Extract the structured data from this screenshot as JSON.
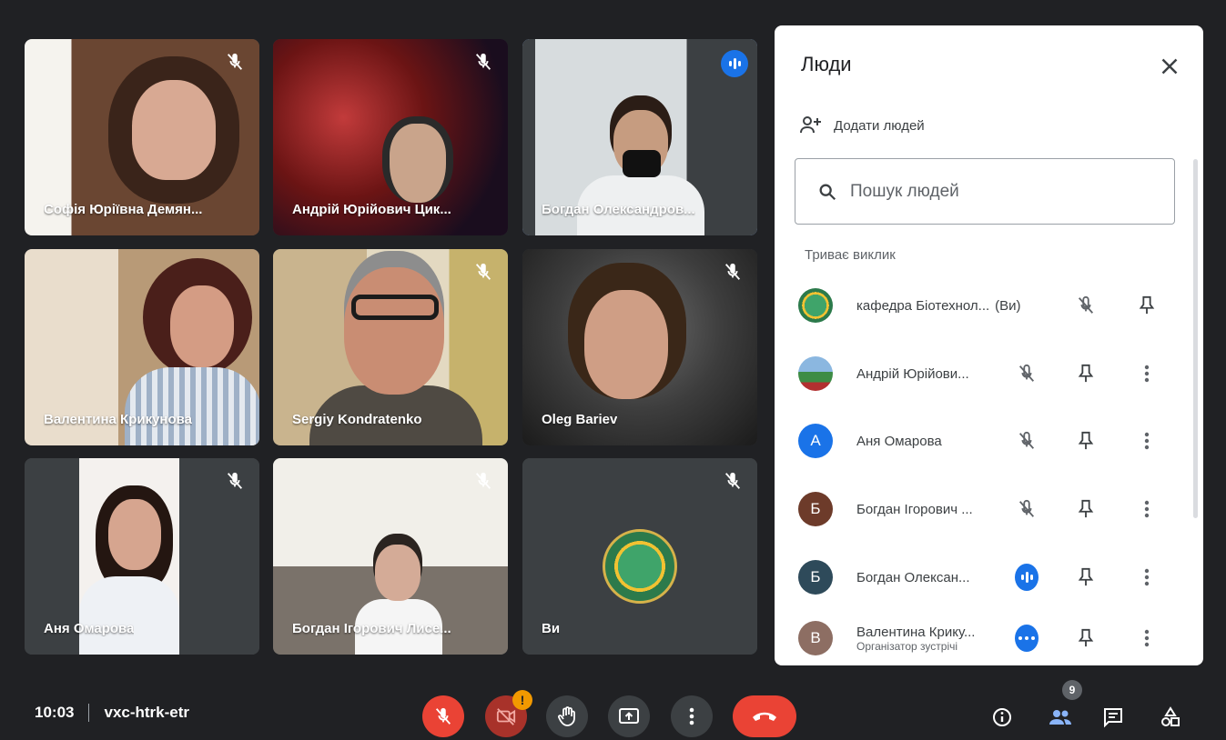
{
  "tiles": [
    {
      "name": "Софія Юріївна Демян...",
      "muted": true
    },
    {
      "name": "Андрій Юрійович Цик...",
      "muted": true
    },
    {
      "name": "Богдан Олександров...",
      "speaking": true
    },
    {
      "name": "Валентина Крикунова"
    },
    {
      "name": "Sergiy Kondratenko",
      "muted": true
    },
    {
      "name": "Oleg Bariev",
      "muted": true
    },
    {
      "name": "Аня Омарова",
      "muted": true
    },
    {
      "name": "Богдан Ігорович Лисе...",
      "muted": true
    },
    {
      "name": "Ви",
      "muted": true
    }
  ],
  "panel": {
    "title": "Люди",
    "add_people": "Додати людей",
    "search_placeholder": "Пошук людей",
    "section": "Триває виклик",
    "people": [
      {
        "name": "кафедра Біотехнол...",
        "you": "(Ви)",
        "status": "muted"
      },
      {
        "name": "Андрій Юрійови...",
        "status": "muted"
      },
      {
        "name": "Аня Омарова",
        "initial": "А",
        "color": "#1a73e8",
        "status": "muted"
      },
      {
        "name": "Богдан Ігорович ...",
        "initial": "Б",
        "color": "#6d3b2a",
        "status": "muted"
      },
      {
        "name": "Богдан Олексан...",
        "initial": "Б",
        "color": "#2e4a5a",
        "status": "speaking"
      },
      {
        "name": "Валентина Крику...",
        "role": "Організатор зустрічі",
        "initial": "В",
        "color": "#8d6e63",
        "status": "active"
      }
    ]
  },
  "bottom": {
    "time": "10:03",
    "meeting_code": "vxc-htrk-etr",
    "camera_alert": "!",
    "participant_count": "9"
  },
  "colors": {
    "background": "#202124",
    "accent": "#1a73e8",
    "danger": "#ea4335",
    "warning": "#f29900"
  }
}
